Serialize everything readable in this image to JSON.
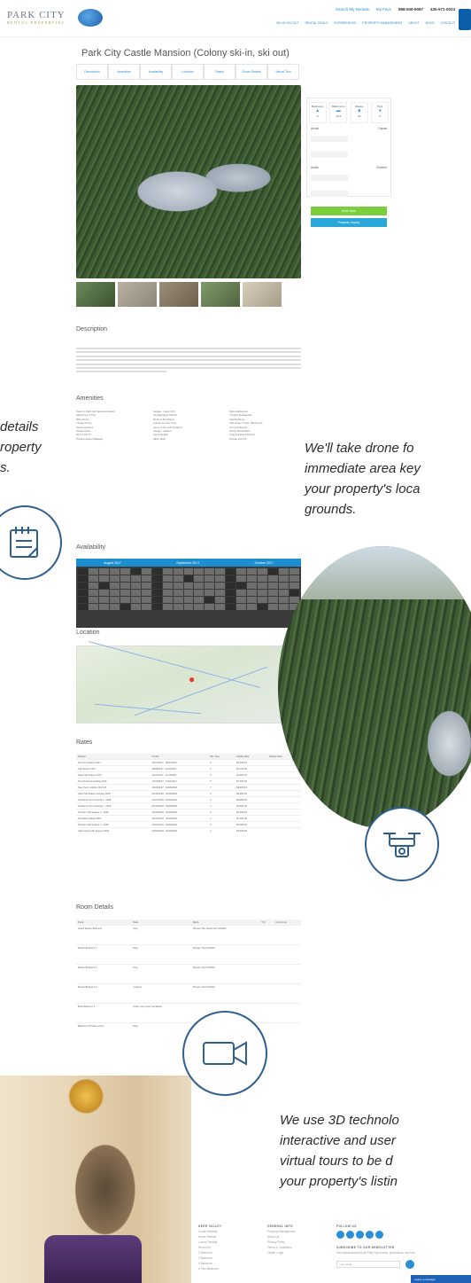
{
  "header": {
    "logo_text": "PARK CITY",
    "logo_sub": "RENTAL PROPERTIES",
    "search_link": "Search My Rentals",
    "favorites_link": "My Favs",
    "phone": "888-509-9087",
    "phone_alt": "435-571-0024",
    "nav": [
      "SKI-IN SKI-OUT",
      "RENTAL DEALS",
      "EXPERIENCES",
      "PROPERTY MANAGEMENT",
      "ABOUT",
      "BLOG",
      "CONTACT"
    ]
  },
  "listing": {
    "title": "Park City Castle Mansion (Colony ski-in, ski out)",
    "tabs": [
      "Description",
      "Amenities",
      "Availability",
      "Location",
      "Rates",
      "Room Details",
      "Virtual Tour"
    ],
    "stats": [
      {
        "label": "Bedrooms",
        "value": "9"
      },
      {
        "label": "Bathrooms",
        "value": "12.5"
      },
      {
        "label": "Sleeps",
        "value": "22"
      },
      {
        "label": "Pets",
        "value": "0"
      }
    ],
    "arrival_label": "Arrival",
    "departure_label": "Depart",
    "adults_label": "Adults",
    "children_label": "Children",
    "book_label": "Book Now",
    "inquiry_label": "Property Inquiry"
  },
  "sections": {
    "description": "Description",
    "amenities": "Amenities",
    "availability": "Availability",
    "location": "Location",
    "rates": "Rates",
    "room_details": "Room Details"
  },
  "amenities": [
    "Steps to Park City Mountain Resort",
    "Garage - Large SUV",
    "Main Appliances",
    "Flat Screen TV(s)",
    "City Equipped Kitchen",
    "Outdoor Refrigerator",
    "Wine Room",
    "Steps to Ski Slopes",
    "Washer/Dryer",
    "Theater Room",
    "Granite Counter Tops",
    "Flat Screen TV(s) - Bedrooms",
    "Internet Access",
    "Home of the Year Designer",
    "Air Conditioning",
    "Private Deck",
    "Garage - Heated",
    "Newly Remodeled",
    "Wi-Fi LCD TV",
    "Gas Fireplace",
    "Fully Equipped Kitchen",
    "Private Heated Walkway",
    "Office Suite",
    "Private Hot Tub"
  ],
  "calendar": {
    "months": [
      "August 2017",
      "September 2017",
      "October 2017"
    ]
  },
  "rates": {
    "columns": [
      "Season",
      "Period",
      "Min. Stay",
      "Nightly Rate",
      "Weekly Rate"
    ],
    "rows": [
      [
        "Summer Season 2017",
        "06/17/2017 - 08/27/2017",
        "4",
        "$3,350.00",
        ""
      ],
      [
        "Fall Season 2017",
        "08/28/2017 - 11/21/2017",
        "3",
        "$3,100.00",
        ""
      ],
      [
        "Value Ski Season 2017",
        "11/22/2017 - 12/14/2017",
        "4",
        "$4,495.00",
        ""
      ],
      [
        "Pre-Christmas Holiday 2016",
        "12/15/2017 - 12/21/2017",
        "5",
        "$7,495.00",
        ""
      ],
      [
        "New Years Holiday 2017-18",
        "12/26/2017 - 01/06/2018",
        "7",
        "$9,995.00",
        ""
      ],
      [
        "Value Ski Season January 2018",
        "01/06/2018 - 01/16/2018",
        "4",
        "$6,995.00",
        ""
      ],
      [
        "Sundance Film Festival 1 - 2018",
        "01/17/2018 - 01/24/2018",
        "4",
        "$6,995.00",
        ""
      ],
      [
        "Sundance Film Festival 2 - 2018",
        "01/25/2018 - 01/29/2018",
        "4",
        "$6,995.00",
        ""
      ],
      [
        "Premium Ski Season 1 - 2018",
        "01/29/2018 - 02/14/2018",
        "4",
        "$6,495.00",
        ""
      ],
      [
        "Presidents Week 2018",
        "02/15/2018 - 02/21/2018",
        "4",
        "$7,995.00",
        ""
      ],
      [
        "Premium Ski Season 2 - 2018",
        "02/22/2018 - 04/01/2018",
        "4",
        "$6,995.00",
        ""
      ],
      [
        "Value Spring Ski Season 2018",
        "04/02/2018 - 04/15/2018",
        "4",
        "$5,495.00",
        ""
      ]
    ]
  },
  "rooms": {
    "columns": [
      "Room",
      "Beds",
      "Baths",
      "TVs",
      "Comments"
    ],
    "rows": [
      [
        "Grand Master Bedroom",
        "King",
        "Shower Tub Jetted Tub Full Bath",
        "",
        ""
      ],
      [
        "Master Bedroom 2",
        "King",
        "Shower Tub Full Bath",
        "",
        ""
      ],
      [
        "Master Bedroom 3",
        "King",
        "Shower Tub Full Bath",
        "",
        ""
      ],
      [
        "Master Bedroom 4",
        "2 Queen",
        "Shower Tub Full Bath",
        "",
        ""
      ],
      [
        "Bunk Bedroom 5",
        "3 twin over queen bunkbeds",
        "",
        "",
        ""
      ],
      [
        "Bedroom 6 Private corner",
        "King",
        "",
        "",
        ""
      ]
    ]
  },
  "marketing": {
    "details_text": [
      "details",
      "roperty",
      "s."
    ],
    "drone_text": [
      "We'll take drone fo",
      "immediate area key",
      "your property's loca",
      "grounds."
    ],
    "tour_text": [
      "We use 3D technolo",
      "interactive and user",
      "virtual tours to be d",
      "your property's listin"
    ]
  },
  "footer": {
    "col1_title": "DEER VALLEY",
    "col1_items": [
      "Condo Rentals",
      "Home Rentals",
      "Luxury Rentals",
      "Ski-In/Out",
      "2 Bedroom",
      "3 Bedroom",
      "4 Bedroom",
      "5 Plus Bedroom"
    ],
    "col2_title": "GENERAL INFO",
    "col2_items": [
      "Property Management",
      "About Us",
      "Privacy Policy",
      "Terms & Conditions",
      "Owner Login"
    ],
    "follow_title": "FOLLOW US",
    "newsletter_title": "SUBSCRIBE TO OUR NEWSLETTER",
    "newsletter_blurb": "Get instant access to all Park City events, promotions, and info.",
    "email_placeholder": "Your email",
    "chat_label": "Leave a message"
  },
  "colors": {
    "accent": "#2a8fd6",
    "book_green": "#7bcf3f",
    "inquiry_blue": "#2aa7d9",
    "icon_ring": "#2f5f8f"
  }
}
